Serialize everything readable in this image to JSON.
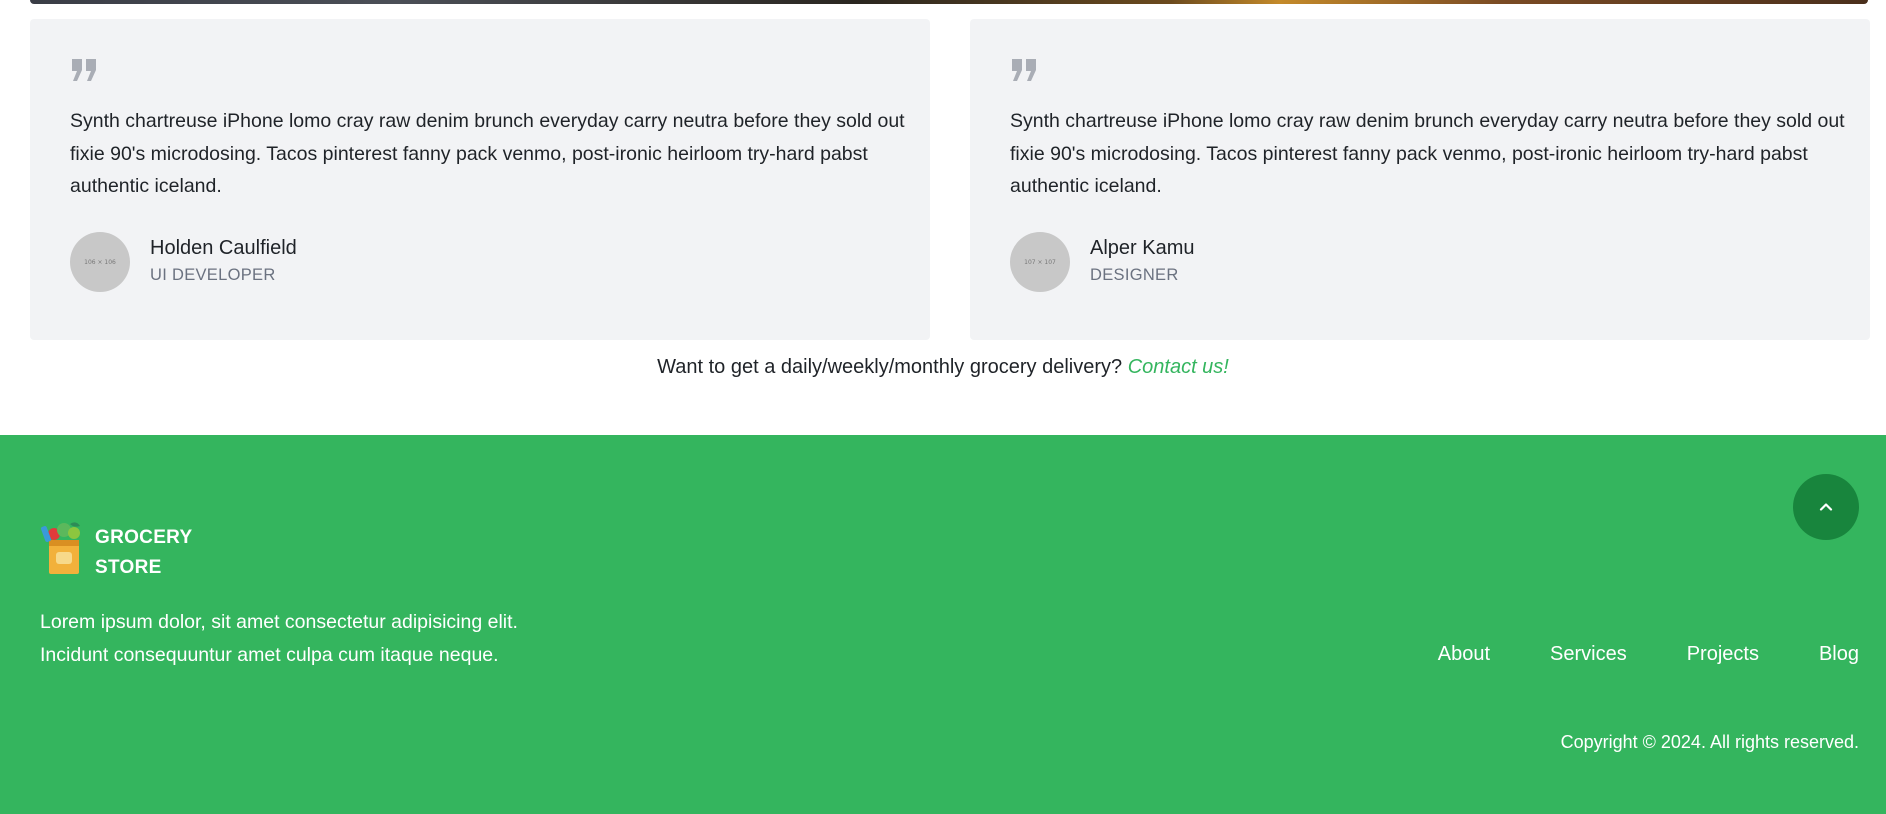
{
  "testimonials": [
    {
      "quote": "Synth chartreuse iPhone lomo cray raw denim brunch everyday carry neutra before they sold out fixie 90's microdosing. Tacos pinterest fanny pack venmo, post-ironic heirloom try-hard pabst authentic iceland.",
      "avatar_placeholder": "106 × 106",
      "name": "Holden Caulfield",
      "role": "UI DEVELOPER"
    },
    {
      "quote": "Synth chartreuse iPhone lomo cray raw denim brunch everyday carry neutra before they sold out fixie 90's microdosing. Tacos pinterest fanny pack venmo, post-ironic heirloom try-hard pabst authentic iceland.",
      "avatar_placeholder": "107 × 107",
      "name": "Alper Kamu",
      "role": "DESIGNER"
    }
  ],
  "cta": {
    "text": "Want to get a daily/weekly/monthly grocery delivery?",
    "link": "Contact us!"
  },
  "footer": {
    "logo_line1": "GROCERY",
    "logo_line2": "STORE",
    "desc_line1": "Lorem ipsum dolor, sit amet consectetur adipisicing elit.",
    "desc_line2": "Incidunt consequuntur amet culpa cum itaque neque.",
    "nav": [
      "About",
      "Services",
      "Projects",
      "Blog"
    ],
    "copyright": "Copyright © 2024. All rights reserved."
  },
  "colors": {
    "brand_green": "#34b55e",
    "scroll_button": "#18853d",
    "card_bg": "#f2f3f5"
  },
  "icons": {
    "quote": "quote-icon",
    "scroll_top": "chevron-up-icon",
    "logo": "grocery-bag-icon"
  }
}
